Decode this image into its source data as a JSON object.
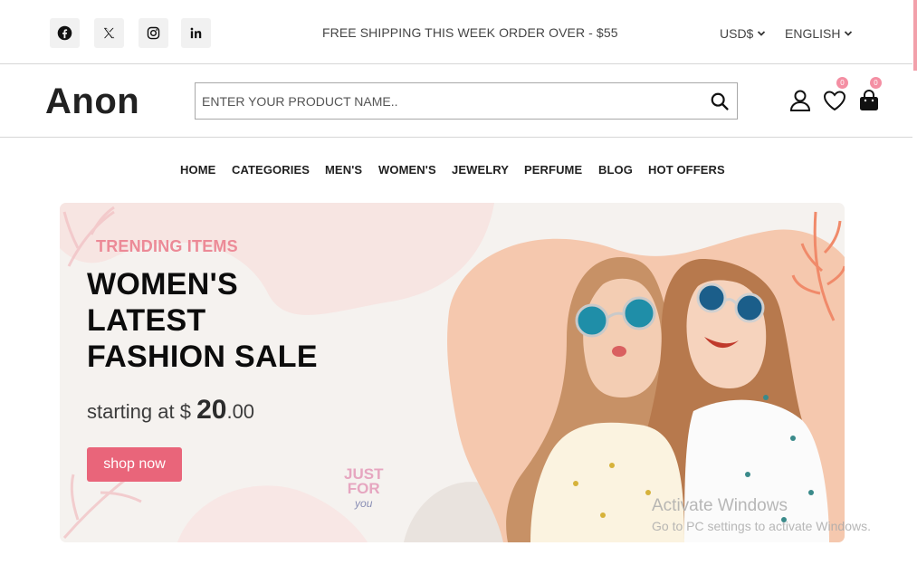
{
  "topbar": {
    "social": [
      "facebook-icon",
      "x-twitter-icon",
      "instagram-icon",
      "linkedin-icon"
    ],
    "shipping_text": "FREE SHIPPING THIS WEEK ORDER OVER - $55",
    "currency": "USD$",
    "language": "ENGLISH"
  },
  "header": {
    "logo": "Anon",
    "search_placeholder": "ENTER YOUR PRODUCT NAME..",
    "wishlist_count": "0",
    "cart_count": "0"
  },
  "nav": {
    "items": [
      "HOME",
      "CATEGORIES",
      "MEN'S",
      "WOMEN'S",
      "JEWELRY",
      "PERFUME",
      "BLOG",
      "HOT OFFERS"
    ]
  },
  "banner": {
    "subtitle": "TRENDING ITEMS",
    "title_line1": "WOMEN'S",
    "title_line2": "LATEST",
    "title_line3": "FASHION SALE",
    "price_prefix": "starting at $ ",
    "price_main": "20",
    "price_cents": ".00",
    "button": "shop now",
    "deco_just": "JUST",
    "deco_for": "FOR",
    "deco_you": "you"
  },
  "watermark": {
    "line1": "Activate Windows",
    "line2": "Go to PC settings to activate Windows."
  },
  "colors": {
    "accent": "#e9657a",
    "trending": "#ec8a97",
    "badge": "#f48fa3"
  }
}
